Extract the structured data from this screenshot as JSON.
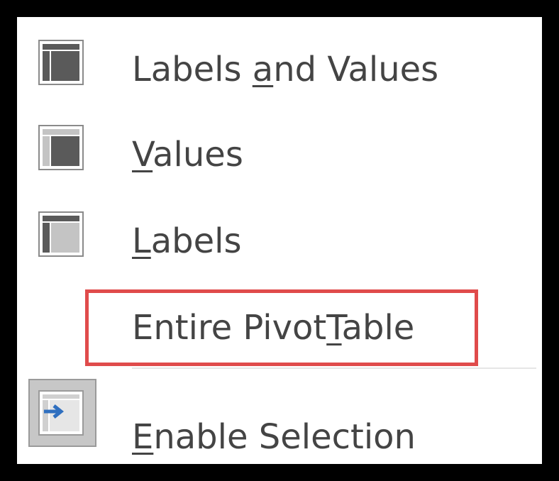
{
  "menu": {
    "items": [
      {
        "pre": "Labels ",
        "key": "a",
        "post": "nd Values",
        "icon": "labels-and-values-icon"
      },
      {
        "pre": "",
        "key": "V",
        "post": "alues",
        "icon": "values-icon"
      },
      {
        "pre": "",
        "key": "L",
        "post": "abels",
        "icon": "labels-icon"
      },
      {
        "pre": "Entire Pivot",
        "key": "T",
        "post": "able",
        "icon": ""
      },
      {
        "pre": "",
        "key": "E",
        "post": "nable Selection",
        "icon": "enable-selection-icon"
      }
    ]
  },
  "colors": {
    "highlight_border": "#e04b4b",
    "text": "#444444",
    "icon_dark": "#5a5a5a",
    "icon_light": "#b0b0b0",
    "arrow": "#2f6fbf"
  }
}
